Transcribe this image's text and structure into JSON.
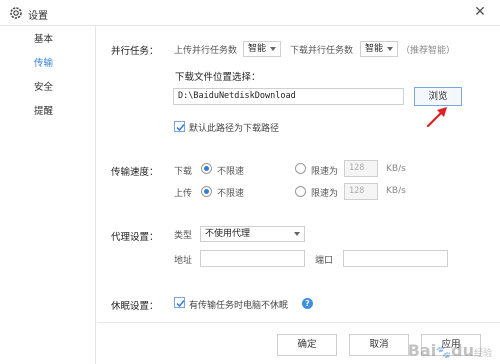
{
  "window": {
    "title": "设置",
    "close_glyph": "✕"
  },
  "sidebar": {
    "items": [
      {
        "label": "基本",
        "active": false
      },
      {
        "label": "传输",
        "active": true
      },
      {
        "label": "安全",
        "active": false
      },
      {
        "label": "提醒",
        "active": false
      }
    ]
  },
  "parallel": {
    "section_label": "并行任务：",
    "upload_label": "上传并行任务数",
    "upload_value": "智能",
    "download_label": "下载并行任务数",
    "download_value": "智能",
    "hint": "（推荐智能）"
  },
  "download_location": {
    "label": "下载文件位置选择：",
    "path": "D:\\BaiduNetdiskDownload",
    "browse_label": "浏览",
    "default_label": "默认此路径为下载路径",
    "default_checked": true
  },
  "speed": {
    "section_label": "传输速度：",
    "download": {
      "label": "下载",
      "unlimited": "不限速",
      "limit": "限速为",
      "value": "128",
      "unit": "KB/s",
      "selected": "unlimited"
    },
    "upload": {
      "label": "上传",
      "unlimited": "不限速",
      "limit": "限速为",
      "value": "128",
      "unit": "KB/s",
      "selected": "unlimited"
    }
  },
  "proxy": {
    "section_label": "代理设置：",
    "type_label": "类型",
    "type_value": "不使用代理",
    "address_label": "地址",
    "address_value": "",
    "port_label": "端口",
    "port_value": ""
  },
  "sleep": {
    "section_label": "休眠设置：",
    "checkbox_label": "有传输任务时电脑不休眠",
    "checked": true,
    "help_glyph": "?"
  },
  "footer": {
    "ok_label": "确定",
    "cancel_label": "取消",
    "apply_label": "应用"
  },
  "watermark": {
    "brand": "Bai",
    "paw": "du",
    "suffix": "经验"
  },
  "colors": {
    "accent": "#2d7fd6",
    "arrow": "#e02020",
    "border": "#cfcfcf"
  }
}
